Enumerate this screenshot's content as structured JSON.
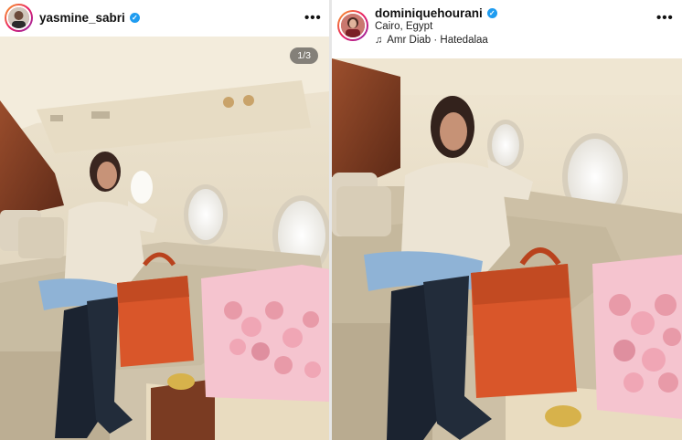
{
  "posts": [
    {
      "username": "yasmine_sabri",
      "verified": true,
      "more_label": "•••",
      "carousel_counter": "1/3",
      "avatar_icon": "profile-photo-icon",
      "menu_icon": "more-options-icon"
    },
    {
      "username": "dominiquehourani",
      "verified": true,
      "location": "Cairo, Egypt",
      "music_track": "Amr Diab · Hatedalaa",
      "music_icon": "music-note-icon",
      "more_label": "•••",
      "avatar_icon": "profile-photo-icon",
      "menu_icon": "more-options-icon"
    }
  ],
  "colors": {
    "verified_badge": "#1f9cf0",
    "cabin_wall": "#ece3cf",
    "wood_panel": "#7a3b22",
    "handbag": "#d9562a",
    "jeans": "#8fb3d6",
    "boots": "#1b2330",
    "flowers": "#f0a6b5"
  }
}
